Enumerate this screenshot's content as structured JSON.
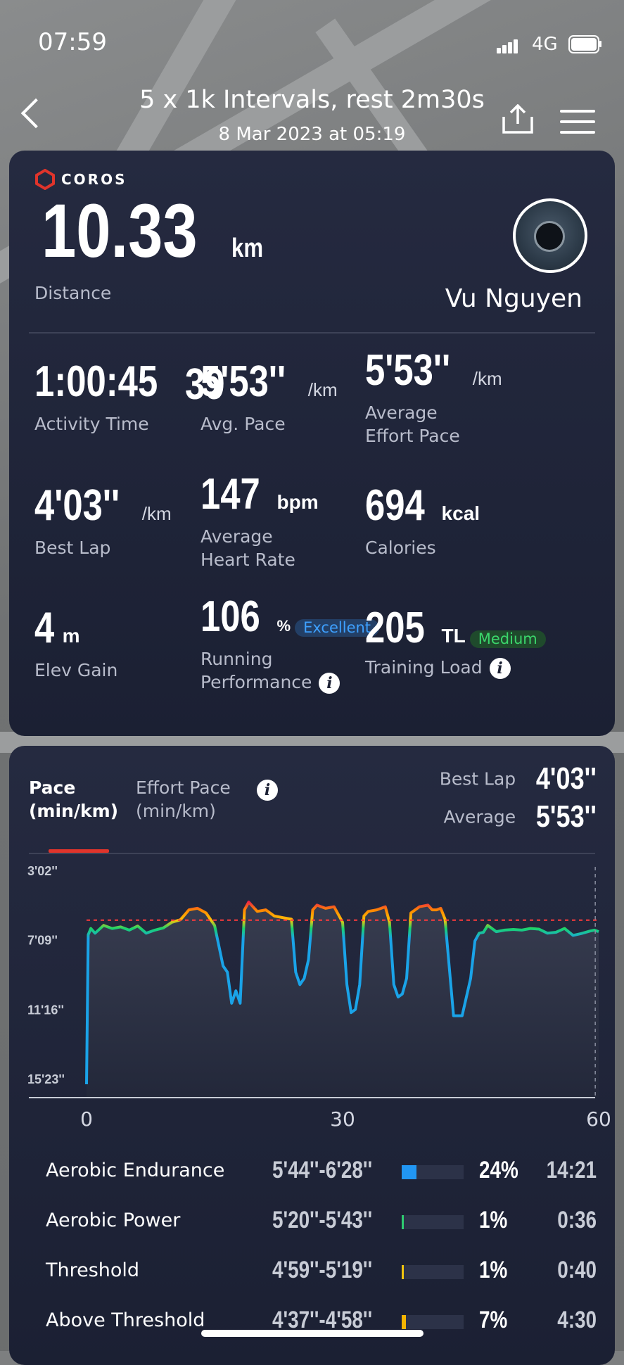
{
  "status": {
    "time": "07:59",
    "network": "4G"
  },
  "header": {
    "title": "5 x 1k Intervals, rest 2m30s",
    "subtitle": "8 Mar 2023 at 05:19"
  },
  "summary": {
    "brand": "COROS",
    "distance": {
      "value": "10.33",
      "unit": "km",
      "label": "Distance"
    },
    "user_name": "Vu Nguyen",
    "stats": {
      "activity_time": {
        "main": "1:00:45",
        "fraction": "39",
        "label": "Activity Time"
      },
      "avg_pace": {
        "value": "5'53''",
        "unit": "/km",
        "label": "Avg. Pace"
      },
      "avg_effort_pace": {
        "value": "5'53''",
        "unit": "/km",
        "label_line1": "Average",
        "label_line2": "Effort Pace"
      },
      "best_lap": {
        "value": "4'03''",
        "unit": "/km",
        "label": "Best Lap"
      },
      "avg_hr": {
        "value": "147",
        "unit": "bpm",
        "label_line1": "Average",
        "label_line2": "Heart Rate"
      },
      "calories": {
        "value": "694",
        "unit": "kcal",
        "label": "Calories"
      },
      "elev_gain": {
        "value": "4",
        "unit": "m",
        "label": "Elev Gain"
      },
      "running_performance": {
        "value": "106",
        "unit": "%",
        "badge": "Excellent",
        "label_line1": "Running",
        "label_line2": "Performance"
      },
      "training_load": {
        "value": "205",
        "unit": "TL",
        "badge": "Medium",
        "label": "Training Load"
      }
    }
  },
  "pace_panel": {
    "tabs": [
      {
        "line1": "Pace",
        "line2": "(min/km)"
      },
      {
        "line1": "Effort Pace",
        "line2": "(min/km)"
      }
    ],
    "best_lap_label": "Best Lap",
    "best_lap_value": "4'03''",
    "average_label": "Average",
    "average_value": "5'53''"
  },
  "chart_data": {
    "type": "line",
    "title": "",
    "xlabel": "",
    "ylabel": "Pace (min/km)",
    "y_tick_labels": [
      "3'02''",
      "7'09''",
      "11'16''",
      "15'23''"
    ],
    "x_tick_labels": [
      "0",
      "30",
      "60"
    ],
    "xlim": [
      0,
      60
    ],
    "ylim_seconds_per_km": [
      182,
      923
    ],
    "y_inverted": true,
    "reference_line": {
      "name": "Average",
      "value_seconds_per_km": 353
    },
    "x": [
      0,
      0.2,
      0.5,
      1,
      2,
      3,
      4,
      5,
      6,
      7,
      8,
      9,
      10,
      11,
      12,
      13,
      14,
      15,
      16,
      16.5,
      17,
      17.5,
      18,
      18.5,
      19,
      19.5,
      20,
      21,
      22,
      23,
      24,
      24.5,
      25,
      25.5,
      26,
      26.5,
      27,
      27.5,
      28,
      29,
      30,
      30.5,
      31,
      31.5,
      32,
      32.5,
      33,
      34,
      35,
      35.5,
      36,
      36.5,
      37,
      37.5,
      38,
      39,
      40,
      40.5,
      41,
      41.5,
      42,
      43,
      44,
      45,
      45.5,
      46,
      46.5,
      47,
      47.5,
      48,
      49,
      50,
      51,
      52,
      53,
      54,
      55,
      56,
      57,
      58,
      59,
      59.5,
      60
    ],
    "values": [
      880,
      400,
      380,
      395,
      370,
      380,
      375,
      385,
      372,
      395,
      385,
      378,
      360,
      352,
      320,
      315,
      330,
      370,
      500,
      520,
      620,
      580,
      620,
      320,
      295,
      310,
      325,
      320,
      340,
      345,
      350,
      520,
      560,
      540,
      480,
      320,
      305,
      310,
      315,
      310,
      360,
      560,
      650,
      640,
      560,
      340,
      325,
      320,
      310,
      360,
      560,
      600,
      590,
      540,
      330,
      310,
      305,
      320,
      320,
      315,
      350,
      660,
      660,
      540,
      420,
      395,
      392,
      370,
      380,
      390,
      385,
      383,
      385,
      380,
      382,
      395,
      392,
      380,
      402,
      396,
      388,
      385,
      390,
      385,
      380
    ]
  },
  "zones": [
    {
      "name": "Aerobic Endurance",
      "range": "5'44''-6'28''",
      "percent": "24%",
      "time": "14:21",
      "fraction": 0.24,
      "color": "#2196f3"
    },
    {
      "name": "Aerobic Power",
      "range": "5'20''-5'43''",
      "percent": "1%",
      "time": "0:36",
      "fraction": 0.01,
      "color": "#2ecc71"
    },
    {
      "name": "Threshold",
      "range": "4'59''-5'19''",
      "percent": "1%",
      "time": "0:40",
      "fraction": 0.01,
      "color": "#f1c40f"
    },
    {
      "name": "Above Threshold",
      "range": "4'37''-4'58''",
      "percent": "7%",
      "time": "4:30",
      "fraction": 0.07,
      "color": "#f4b400"
    }
  ]
}
